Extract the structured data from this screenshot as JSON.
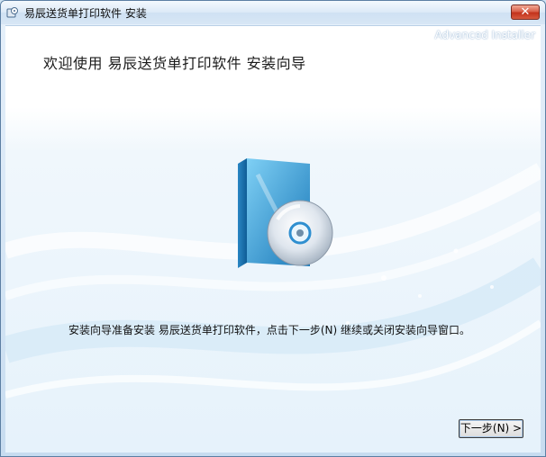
{
  "window": {
    "title": "易辰送货单打印软件 安装",
    "close_label": "✕"
  },
  "wizard": {
    "brand": "Advanced Installer",
    "heading": "欢迎使用 易辰送货单打印软件 安装向导",
    "message": "安装向导准备安装 易辰送货单打印软件，点击下一步(N) 继续或关闭安装向导窗口。",
    "next_label": "下一步(N) >"
  },
  "icons": {
    "app": "installer-app-icon",
    "product": "software-box-cd-icon",
    "close": "close-icon"
  },
  "colors": {
    "accent": "#2f8fd0",
    "close": "#c3321c"
  }
}
